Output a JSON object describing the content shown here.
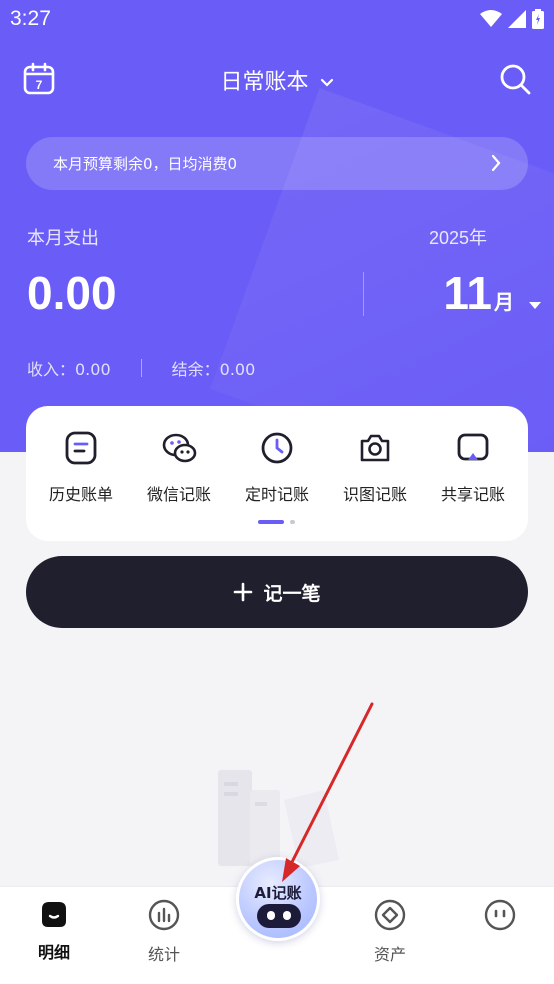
{
  "status_bar": {
    "time": "3:27"
  },
  "header": {
    "title": "日常账本"
  },
  "budget": {
    "text": "本月预算剩余0，日均消费0"
  },
  "overview": {
    "spend_label": "本月支出",
    "spend_value": "0.00",
    "year": "2025年",
    "month_number": "11",
    "month_unit": "月",
    "income_text": "收入：0.00",
    "balance_text": "结余：0.00"
  },
  "quick_actions": [
    {
      "label": "历史账单",
      "icon": "bill-list-icon"
    },
    {
      "label": "微信记账",
      "icon": "wechat-icon"
    },
    {
      "label": "定时记账",
      "icon": "clock-icon"
    },
    {
      "label": "识图记账",
      "icon": "camera-icon"
    },
    {
      "label": "共享记账",
      "icon": "share-screen-icon"
    }
  ],
  "record_button": {
    "label": "记一笔"
  },
  "bottom_nav": {
    "items": [
      {
        "label": "明细",
        "icon": "detail-home-icon",
        "active": true
      },
      {
        "label": "统计",
        "icon": "stats-icon",
        "active": false
      },
      {
        "label": "资产",
        "icon": "asset-diamond-icon",
        "active": false
      },
      {
        "label": "",
        "icon": "profile-face-icon",
        "active": false
      }
    ],
    "ai_button_label": "AI记账"
  },
  "colors": {
    "primary": "#6a5cf6",
    "dark_button": "#1f1f2e",
    "annotation_arrow": "#d62828"
  }
}
